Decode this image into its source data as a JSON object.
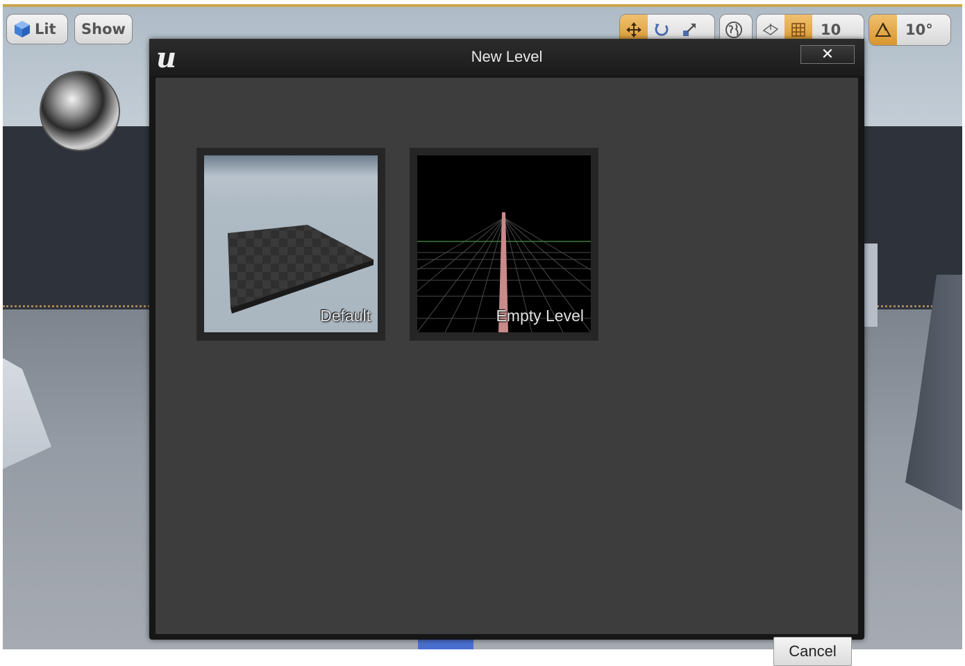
{
  "viewport": {
    "lit_label": "Lit",
    "show_label": "Show",
    "grid_snap_value": "10",
    "rotation_snap_value": "10°"
  },
  "dialog": {
    "title": "New Level",
    "close_glyph": "✕",
    "templates": [
      {
        "label": "Default"
      },
      {
        "label": "Empty Level"
      }
    ],
    "cancel_label": "Cancel"
  },
  "colors": {
    "dialog_background": "#3d3d3d",
    "titlebar": "#1a1a1a",
    "active_tool": "#d8962e"
  },
  "icons": [
    "cube-icon",
    "translate-icon",
    "rotate-icon",
    "scale-icon",
    "world-icon",
    "surface-snap-icon",
    "grid-icon",
    "angle-icon",
    "unreal-logo-icon",
    "close-icon"
  ]
}
